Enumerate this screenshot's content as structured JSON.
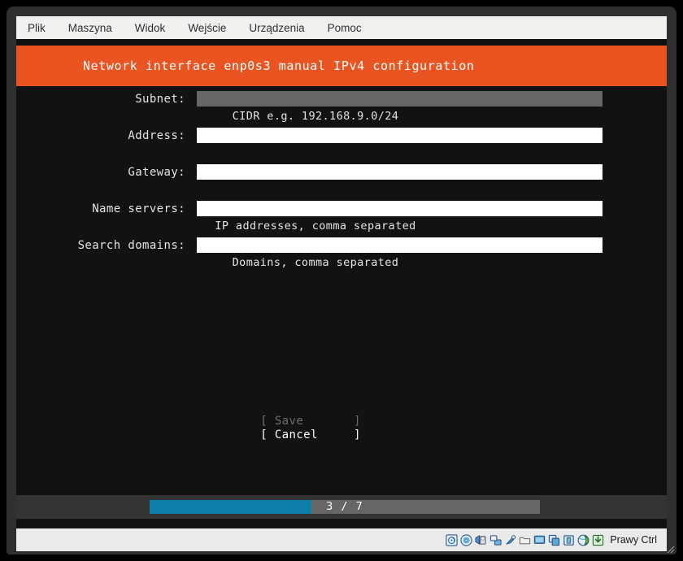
{
  "window": {
    "menubar": [
      {
        "label": "Plik",
        "name": "menu-plik"
      },
      {
        "label": "Maszyna",
        "name": "menu-maszyna"
      },
      {
        "label": "Widok",
        "name": "menu-widok"
      },
      {
        "label": "Wejście",
        "name": "menu-wejscie"
      },
      {
        "label": "Urządzenia",
        "name": "menu-urzadzenia"
      },
      {
        "label": "Pomoc",
        "name": "menu-pomoc"
      }
    ]
  },
  "installer": {
    "title": "Network interface enp0s3 manual IPv4 configuration",
    "header_color": "#e95420",
    "background_color": "#121212",
    "fields": [
      {
        "label": "Subnet:",
        "value": "",
        "hint": "CIDR e.g. 192.168.9.0/24",
        "focused": true
      },
      {
        "label": "Address:",
        "value": "",
        "hint": "",
        "focused": false
      },
      {
        "label": "Gateway:",
        "value": "",
        "hint": "",
        "focused": false
      },
      {
        "label": "Name servers:",
        "value": "",
        "hint": "IP addresses, comma separated",
        "focused": false
      },
      {
        "label": "Search domains:",
        "value": "",
        "hint": "Domains, comma separated",
        "focused": false
      }
    ],
    "buttons": {
      "save": "[ Save       ]",
      "cancel": "[ Cancel     ]"
    },
    "progress": {
      "text": "3 / 7",
      "current": 3,
      "total": 7,
      "percent": 41.5,
      "fill_color": "#0e7fa8",
      "track_color": "#666666"
    }
  },
  "statusbar": {
    "icons": [
      {
        "name": "hard-disk-icon"
      },
      {
        "name": "optical-disc-icon"
      },
      {
        "name": "floppy-disk-icon"
      },
      {
        "name": "network-icon"
      },
      {
        "name": "usb-icon"
      },
      {
        "name": "shared-folders-icon"
      },
      {
        "name": "display-icon"
      },
      {
        "name": "recording-icon"
      },
      {
        "name": "cpu-icon"
      },
      {
        "name": "remote-desktop-icon"
      },
      {
        "name": "host-capture-icon"
      }
    ],
    "host_key": "Prawy Ctrl"
  }
}
